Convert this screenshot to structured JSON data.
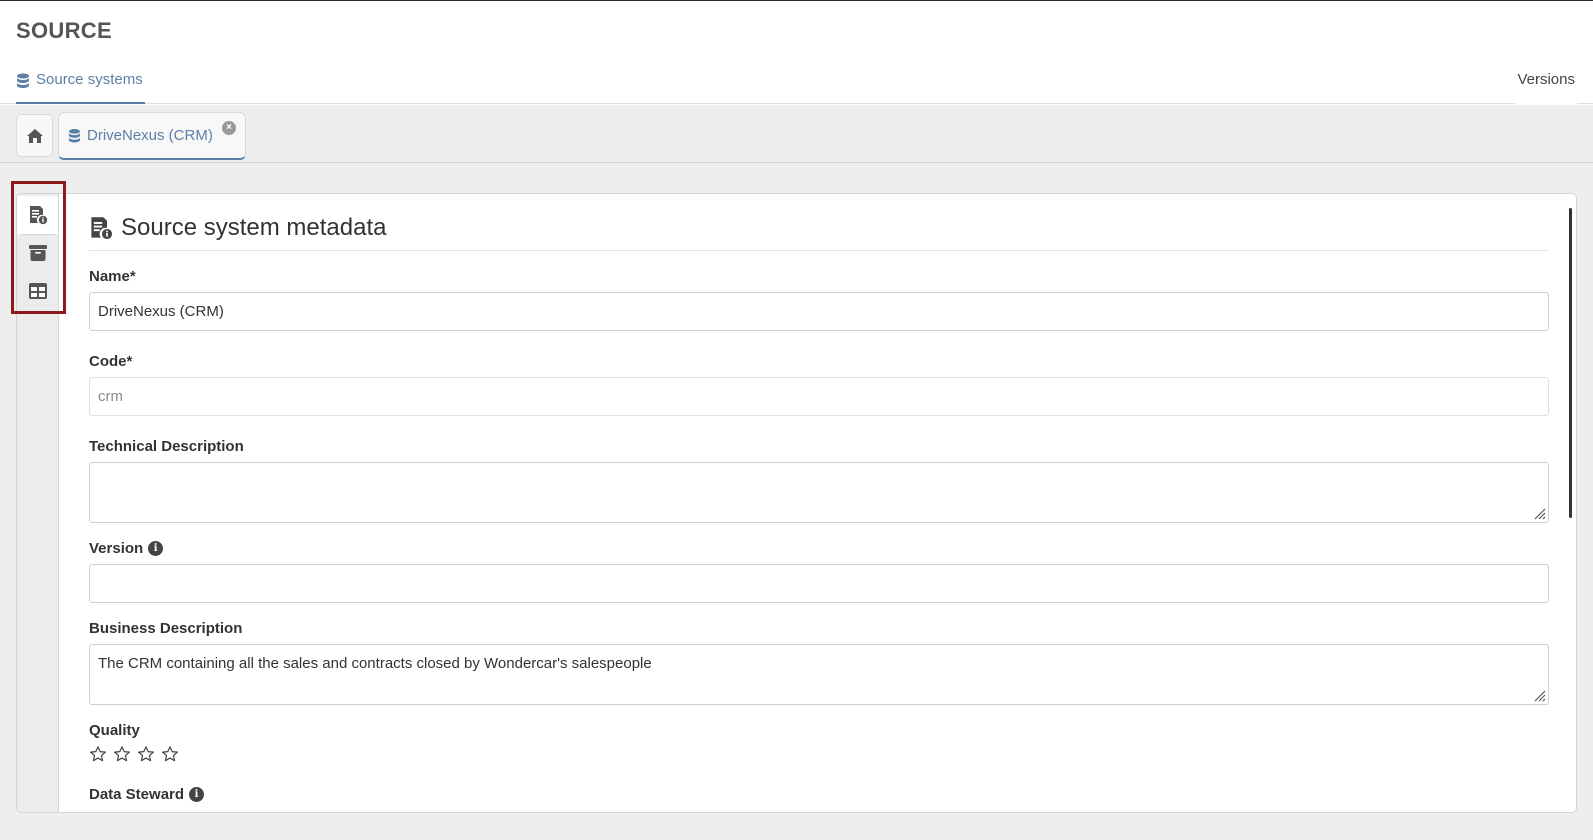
{
  "app": {
    "title": "SOURCE"
  },
  "nav": {
    "left_tab": "Source systems",
    "right_tab": "Versions"
  },
  "tabs": {
    "home_icon": "home-icon",
    "open_record": "DriveNexus (CRM)",
    "close_glyph": "×"
  },
  "side_rail": {
    "items": [
      "metadata-info-icon",
      "archive-icon",
      "table-icon"
    ],
    "active": 0
  },
  "section": {
    "title": "Source system metadata",
    "icon": "document-info-icon"
  },
  "form": {
    "name": {
      "label": "Name*",
      "value": "DriveNexus (CRM)"
    },
    "code": {
      "label": "Code*",
      "value": "crm"
    },
    "technical_description": {
      "label": "Technical Description",
      "value": ""
    },
    "version": {
      "label": "Version",
      "value": ""
    },
    "business_description": {
      "label": "Business Description",
      "value": "The CRM containing all the sales and contracts closed by Wondercar's salespeople"
    },
    "quality": {
      "label": "Quality",
      "rating": 0,
      "max": 4
    },
    "data_steward": {
      "label": "Data Steward"
    }
  },
  "colors": {
    "accent": "#5c7fa6",
    "highlight": "#8b1a1a"
  }
}
